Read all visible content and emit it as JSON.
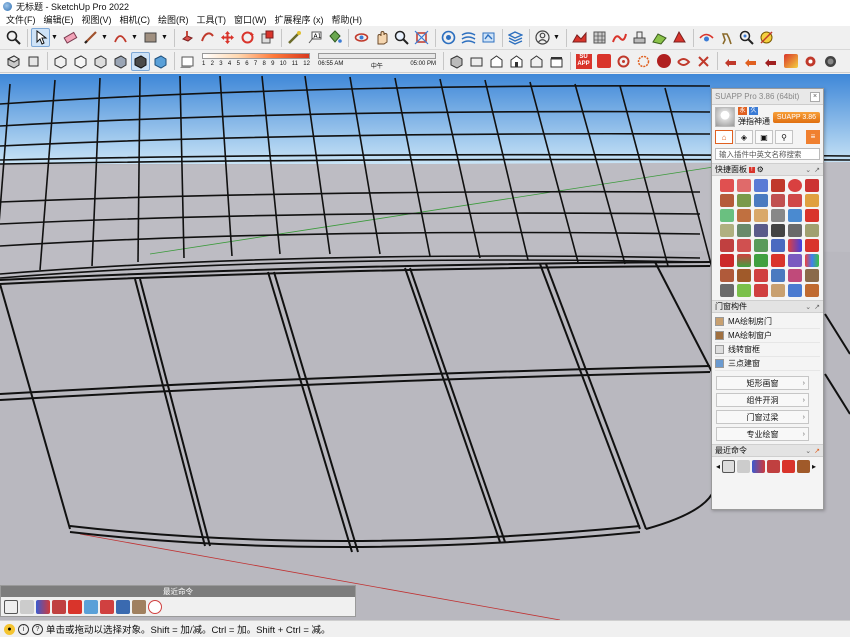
{
  "window": {
    "title": "无标题 - SketchUp Pro 2022"
  },
  "menu": [
    "文件(F)",
    "编辑(E)",
    "视图(V)",
    "相机(C)",
    "绘图(R)",
    "工具(T)",
    "窗口(W)",
    "扩展程序 (x)",
    "帮助(H)"
  ],
  "toolbar1": {
    "icons": [
      "zoom-icon",
      "select-icon",
      "eraser-icon",
      "pencil-line-icon",
      "arc-icon",
      "paint-bucket-icon",
      "push-pull-icon",
      "move-icon",
      "rotate-icon",
      "scale-icon",
      "offset-icon",
      "tape-measure-icon",
      "text-label-icon",
      "dimension-icon",
      "orbit-icon",
      "pan-icon",
      "zoom-window-icon",
      "zoom-extents-icon",
      "component-icon",
      "layers-icon",
      "materials-icon",
      "styles-icon",
      "user-account-icon",
      "warehouse-icon",
      "extension-warehouse-icon",
      "sandbox-icon",
      "solid-tools-icon",
      "section-plane-icon",
      "scenes-icon",
      "advanced-camera-icon",
      "walkthrough-icon",
      "position-camera-icon",
      "look-around-icon"
    ]
  },
  "toolbar2": {
    "shadow_ticks": [
      "1",
      "2",
      "3",
      "4",
      "5",
      "6",
      "7",
      "8",
      "9",
      "10",
      "11",
      "12"
    ],
    "time_start": "06:55 AM",
    "time_mid": "中午",
    "time_end": "05:00 PM"
  },
  "suapp": {
    "title": "SUAPP Pro 3.86 (64bit)",
    "username": "弹指神通",
    "badge": "SUAPP 3.86",
    "search_placeholder": "输入插件中英文名称搜索",
    "quick_panel_label": "快捷面板",
    "door_section_label": "门窗构件",
    "plugin_items": [
      "MA绘制房门",
      "MA绘制窗户",
      "线转窗框",
      "三点建窗"
    ],
    "plugin_buttons": [
      "矩形画窗",
      "组件开洞",
      "门窗过梁",
      "专业绘窗"
    ],
    "recent_label": "最近命令"
  },
  "bottom_panel": {
    "title": "最近命令"
  },
  "status": {
    "text": "单击或拖动以选择对象。Shift = 加/减。Ctrl = 加。Shift + Ctrl = 减。"
  },
  "colors": {
    "sky_top": "#3e87d8",
    "sky_bottom": "#c9e4f6",
    "ground": "#b9b8bf",
    "accent": "#e06020"
  }
}
